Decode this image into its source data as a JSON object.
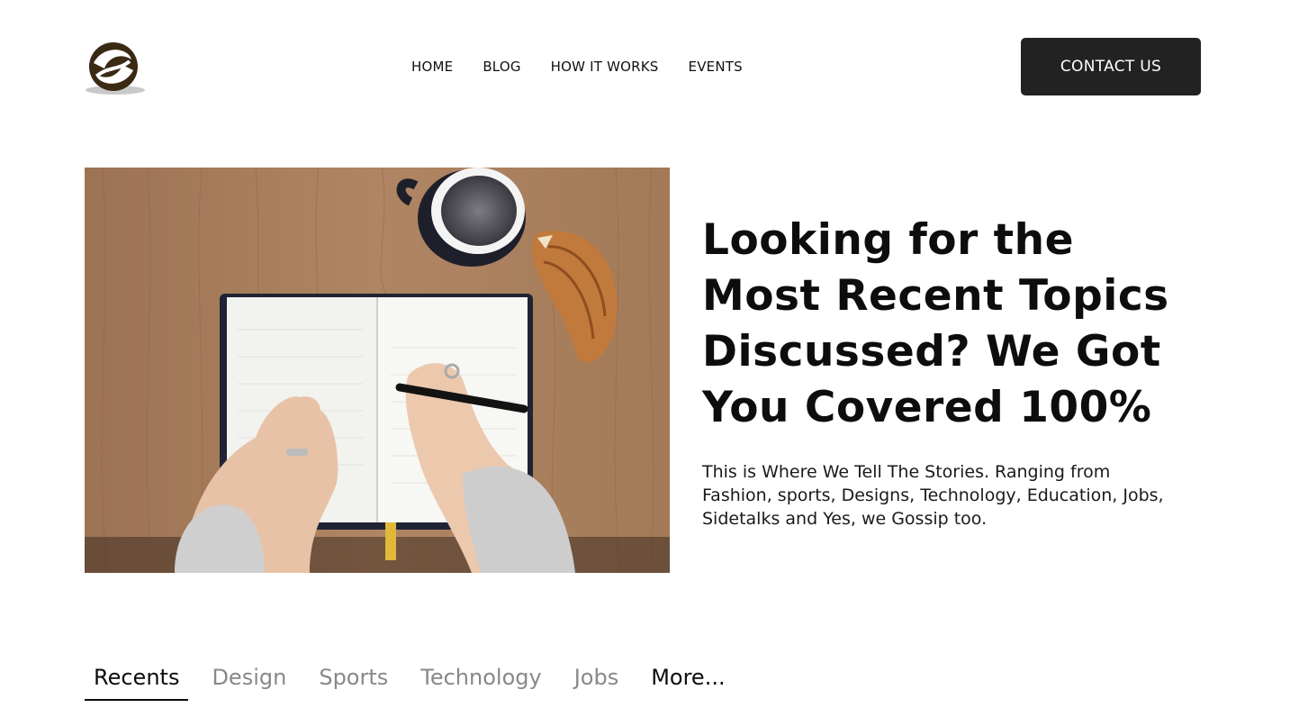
{
  "header": {
    "logo_icon": "swirl-logo-icon",
    "nav": [
      "HOME",
      "BLOG",
      "HOW IT WORKS",
      "EVENTS"
    ],
    "contact_label": "CONTACT US"
  },
  "hero": {
    "image_icon": "notebook-coffee-photo",
    "title": "Looking for the Most Recent Topics Discussed? We Got You Covered 100%",
    "description": "This is Where We Tell The Stories. Ranging from Fashion, sports, Designs, Technology, Education, Jobs, Sidetalks and Yes, we Gossip too."
  },
  "tabs": {
    "items": [
      "Recents",
      "Design",
      "Sports",
      "Technology",
      "Jobs",
      "More..."
    ],
    "active": "Recents"
  },
  "colors": {
    "button_bg": "#222222",
    "text_dark": "#0d0d0d",
    "tab_inactive": "#888888"
  }
}
